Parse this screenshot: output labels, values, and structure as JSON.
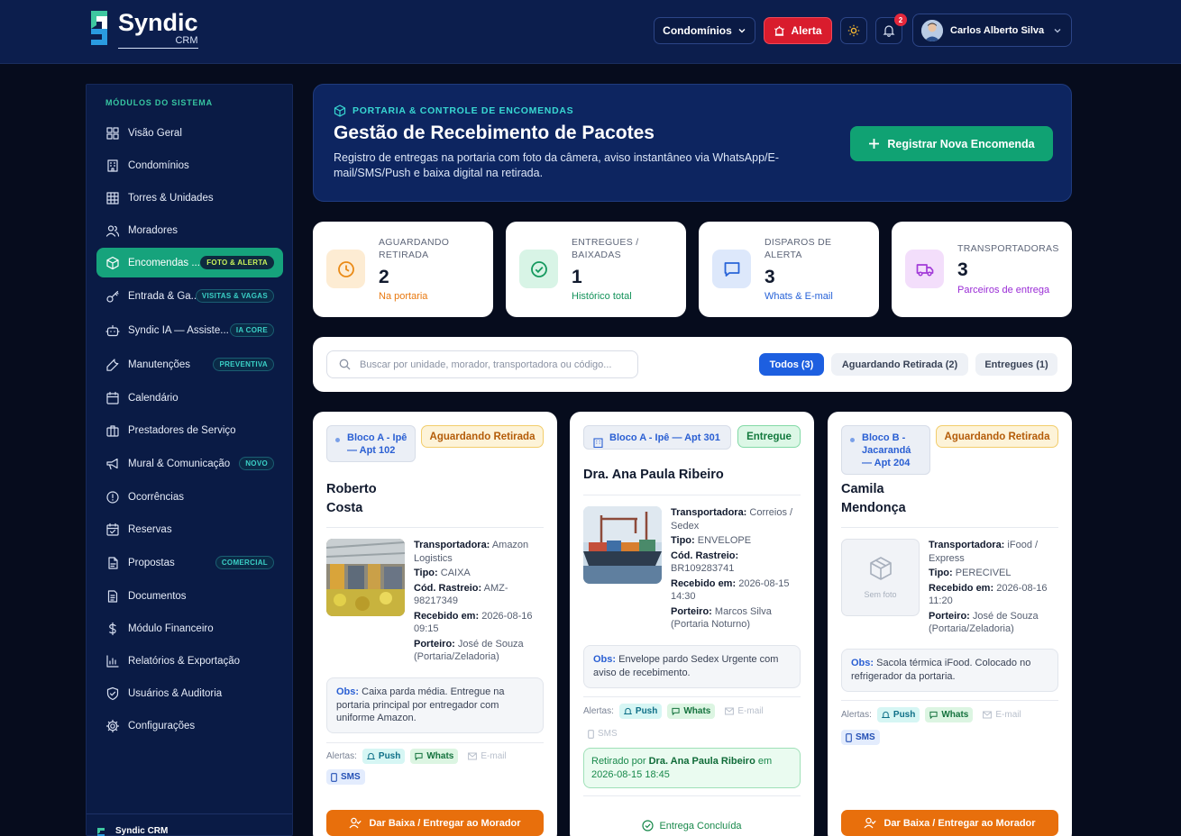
{
  "app": {
    "name": "Syndic",
    "sub": "CRM"
  },
  "header": {
    "condominios_label": "Condomínios",
    "alerta_label": "Alerta",
    "notifications_count": "2",
    "user_name": "Carlos Alberto Silva"
  },
  "sidebar": {
    "title": "MÓDULOS DO SISTEMA",
    "items": [
      {
        "label": "Visão Geral",
        "icon": "grid-icon"
      },
      {
        "label": "Condomínios",
        "icon": "building-icon"
      },
      {
        "label": "Torres & Unidades",
        "icon": "table-icon"
      },
      {
        "label": "Moradores",
        "icon": "users-icon"
      },
      {
        "label": "Encomendas ...",
        "icon": "package-icon",
        "tag": "FOTO & ALERTA",
        "active": true
      },
      {
        "label": "Entrada & Ga...",
        "icon": "key-icon",
        "tag": "VISITAS & VAGAS"
      },
      {
        "label": "Syndic IA — Assiste...",
        "icon": "bot-icon",
        "tag": "IA CORE"
      },
      {
        "label": "Manutenções",
        "icon": "wrench-icon",
        "tag": "PREVENTIVA"
      },
      {
        "label": "Calendário",
        "icon": "calendar-icon"
      },
      {
        "label": "Prestadores de Serviço",
        "icon": "briefcase-icon"
      },
      {
        "label": "Mural & Comunicação",
        "icon": "megaphone-icon",
        "tag": "NOVO"
      },
      {
        "label": "Ocorrências",
        "icon": "alert-circle-icon"
      },
      {
        "label": "Reservas",
        "icon": "calendar-check-icon"
      },
      {
        "label": "Propostas",
        "icon": "proposal-icon",
        "tag": "COMERCIAL"
      },
      {
        "label": "Documentos",
        "icon": "document-icon"
      },
      {
        "label": "Módulo Financeiro",
        "icon": "dollar-icon"
      },
      {
        "label": "Relatórios & Exportação",
        "icon": "bar-chart-icon"
      },
      {
        "label": "Usuários & Auditoria",
        "icon": "shield-icon"
      },
      {
        "label": "Configurações",
        "icon": "gear-icon"
      }
    ],
    "footer": "Syndic CRM"
  },
  "banner": {
    "tag": "PORTARIA & CONTROLE DE ENCOMENDAS",
    "title": "Gestão de Recebimento de Pacotes",
    "description": "Registro de entregas na portaria com foto da câmera, aviso instantâneo via WhatsApp/E-mail/SMS/Push e baixa digital na retirada.",
    "button": "Registrar Nova Encomenda"
  },
  "stats": [
    {
      "label": "AGUARDANDO RETIRADA",
      "value": "2",
      "sub": "Na portaria",
      "color": "#e8780f"
    },
    {
      "label": "ENTREGUES / BAIXADAS",
      "value": "1",
      "sub": "Histórico total",
      "color": "#13925a"
    },
    {
      "label": "DISPAROS DE ALERTA",
      "value": "3",
      "sub": "Whats & E-mail",
      "color": "#2863d8"
    },
    {
      "label": "TRANSPORTADORAS",
      "value": "3",
      "sub": "Parceiros de entrega",
      "color": "#9a2cd6"
    }
  ],
  "search": {
    "placeholder": "Buscar por unidade, morador, transportadora ou código..."
  },
  "filters": [
    "Todos (3)",
    "Aguardando Retirada (2)",
    "Entregues (1)"
  ],
  "cards": [
    {
      "unit": "Bloco A - Ipê — Apt 102",
      "status": "Aguardando Retirada",
      "name": "Roberto Costa",
      "labels": {
        "carrier": "Transportadora:",
        "type": "Tipo:",
        "code": "Cód. Rastreio:",
        "received": "Recebido em:",
        "porter": "Porteiro:",
        "obs": "Obs:",
        "alerts": "Alertas:"
      },
      "carrier": "Amazon Logistics",
      "type": "CAIXA",
      "code": "AMZ-98217349",
      "received": "2026-08-16 09:15",
      "porter": "José de Souza (Portaria/Zeladoria)",
      "obs": "Caixa parda média. Entregue na portaria principal por entregador com uniforme Amazon.",
      "alerts": [
        "Push",
        "Whats",
        "E-mail",
        "SMS"
      ],
      "button": "Dar Baixa / Entregar ao Morador"
    },
    {
      "unit": "Bloco A - Ipê — Apt 301",
      "status": "Entregue",
      "name": "Dra. Ana Paula Ribeiro",
      "labels": {
        "carrier": "Transportadora:",
        "type": "Tipo:",
        "code": "Cód. Rastreio:",
        "received": "Recebido em:",
        "porter": "Porteiro:",
        "obs": "Obs:",
        "alerts": "Alertas:"
      },
      "carrier": "Correios / Sedex",
      "type": "ENVELOPE",
      "code": "BR109283741",
      "received": "2026-08-15 14:30",
      "porter": "Marcos Silva (Portaria Noturno)",
      "obs": "Envelope pardo Sedex Urgente com aviso de recebimento.",
      "alerts": [
        "Push",
        "Whats",
        "E-mail",
        "SMS"
      ],
      "retirado_prefix": "Retirado por",
      "retirado_by": "Dra. Ana Paula Ribeiro",
      "retirado_em": "em",
      "retirado_date": "2026-08-15 18:45",
      "concluida": "Entrega Concluída"
    },
    {
      "unit": "Bloco B - Jacarandá — Apt 204",
      "status": "Aguardando Retirada",
      "name": "Camila Mendonça",
      "labels": {
        "carrier": "Transportadora:",
        "type": "Tipo:",
        "code": "",
        "received": "Recebido em:",
        "porter": "Porteiro:",
        "obs": "Obs:",
        "alerts": "Alertas:"
      },
      "no_photo": "Sem foto",
      "carrier": "iFood / Express",
      "type": "PERECIVEL",
      "received": "2026-08-16 11:20",
      "porter": "José de Souza (Portaria/Zeladoria)",
      "obs": "Sacola térmica iFood. Colocado no refrigerador da portaria.",
      "alerts": [
        "Push",
        "Whats",
        "E-mail",
        "SMS"
      ],
      "button": "Dar Baixa / Entregar ao Morador"
    }
  ]
}
